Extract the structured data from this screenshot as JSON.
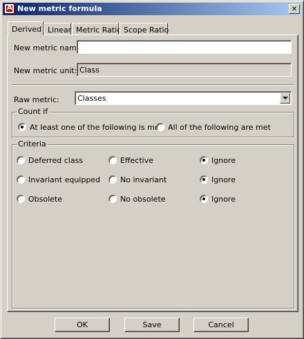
{
  "window": {
    "title": "New metric formula",
    "close_glyph": "✕",
    "app_icon_letter": "A"
  },
  "tabs": [
    {
      "label": "Derived",
      "active": true
    },
    {
      "label": "Linear",
      "active": false
    },
    {
      "label": "Metric Ratio",
      "active": false
    },
    {
      "label": "Scope Ratio",
      "active": false
    }
  ],
  "form": {
    "name_label": "New metric name:",
    "name_value": "",
    "unit_label": "New metric unit:",
    "unit_value": "Class",
    "raw_label": "Raw metric:",
    "raw_value": "Classes"
  },
  "count_if": {
    "title": "Count if",
    "options": [
      {
        "label": "At least one of the following is met",
        "selected": true
      },
      {
        "label": "All of the following are met",
        "selected": false
      }
    ]
  },
  "criteria": {
    "title": "Criteria",
    "rows": [
      {
        "a": "Deferred class",
        "b": "Effective",
        "c": "Ignore",
        "selected": "c"
      },
      {
        "a": "Invariant equipped",
        "b": "No invariant",
        "c": "Ignore",
        "selected": "c"
      },
      {
        "a": "Obsolete",
        "b": "No obsolete",
        "c": "Ignore",
        "selected": "c"
      }
    ]
  },
  "buttons": {
    "ok": "OK",
    "save": "Save",
    "cancel": "Cancel"
  }
}
